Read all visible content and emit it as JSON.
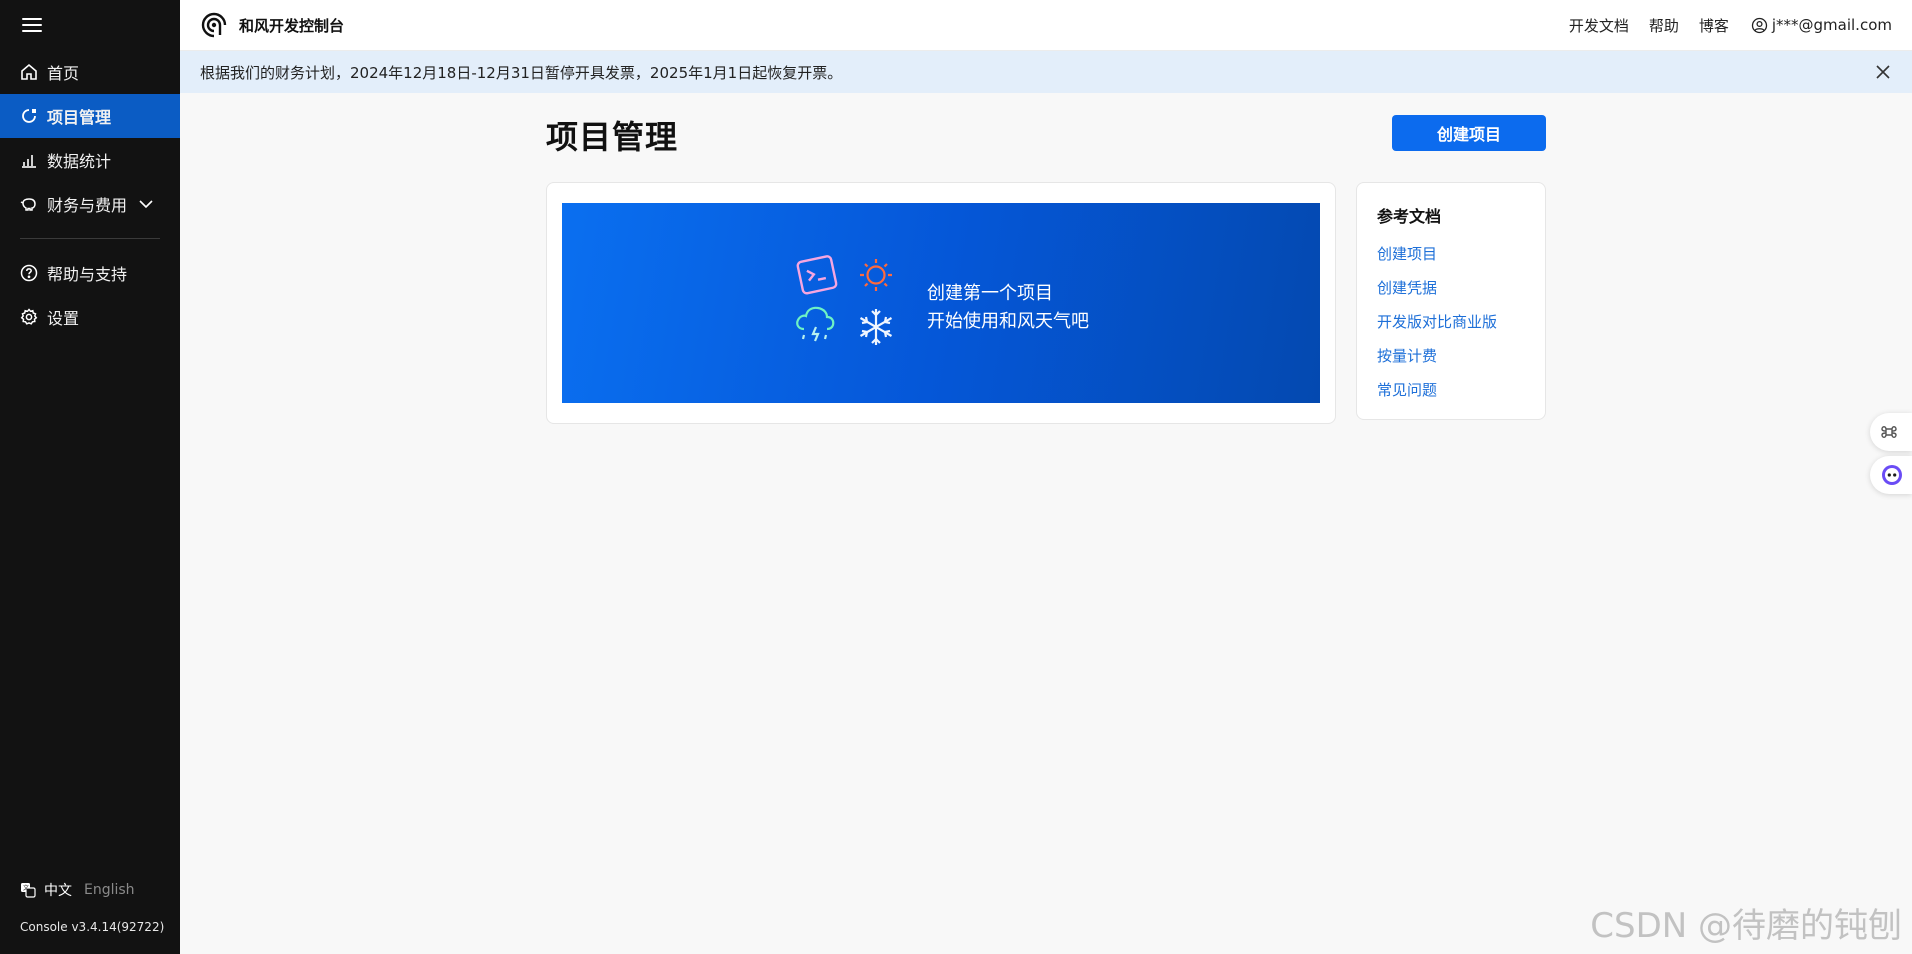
{
  "sidebar": {
    "items": [
      {
        "label": "首页",
        "icon": "home-icon"
      },
      {
        "label": "项目管理",
        "icon": "project-icon",
        "active": true
      },
      {
        "label": "数据统计",
        "icon": "bar-chart-icon"
      },
      {
        "label": "财务与费用",
        "icon": "piggy-bank-icon",
        "expandable": true
      },
      {
        "label": "帮助与支持",
        "icon": "help-icon"
      },
      {
        "label": "设置",
        "icon": "gear-icon"
      }
    ],
    "lang_zh": "中文",
    "lang_en": "English",
    "version": "Console v3.4.14(92722)"
  },
  "header": {
    "brand": "和风开发控制台",
    "links": {
      "docs": "开发文档",
      "help": "帮助",
      "blog": "博客"
    },
    "user_email": "j***@gmail.com"
  },
  "notice": {
    "text": "根据我们的财务计划，2024年12月18日-12月31日暂停开具发票，2025年1月1日起恢复开票。"
  },
  "main": {
    "title": "项目管理",
    "create_button": "创建项目",
    "banner": {
      "line1": "创建第一个项目",
      "line2": "开始使用和风天气吧"
    }
  },
  "docs": {
    "title": "参考文档",
    "links": [
      "创建项目",
      "创建凭据",
      "开发版对比商业版",
      "按量计费",
      "常见问题"
    ]
  },
  "watermark": "CSDN @待磨的钝刨",
  "colors": {
    "accent": "#0c6bee",
    "sidebar_bg": "#121212",
    "sidebar_active": "#0b5cc4",
    "notice_bg": "#e3eefa",
    "link": "#1d6fd8"
  }
}
